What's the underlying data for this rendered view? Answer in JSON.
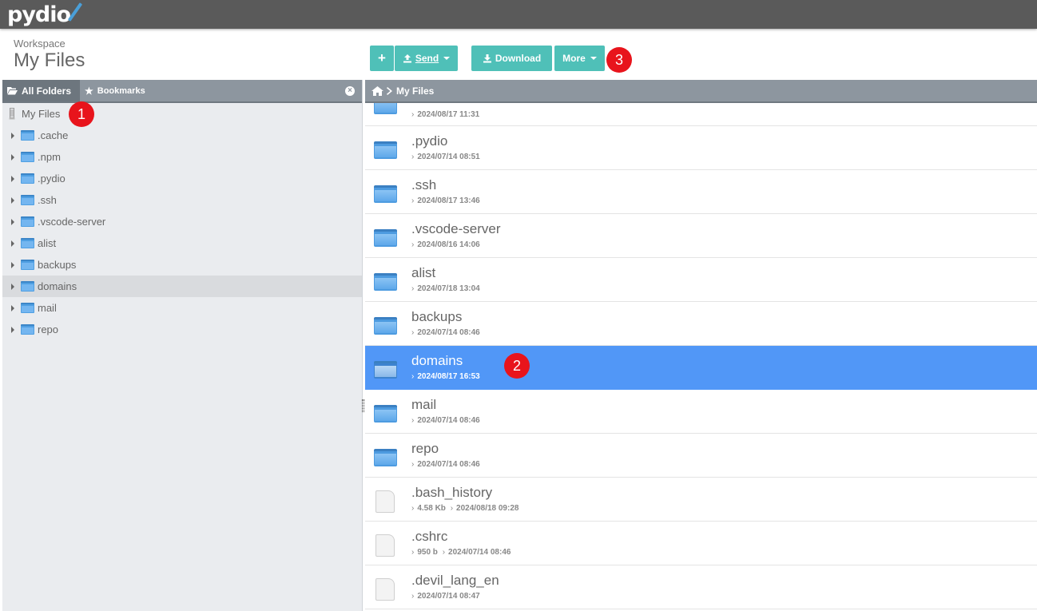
{
  "app": {
    "logo_text": "pydio"
  },
  "header": {
    "workspace_label": "Workspace",
    "title": "My Files"
  },
  "toolbar": {
    "new_label": "+",
    "send_label": "Send",
    "download_label": "Download",
    "more_label": "More"
  },
  "badges": [
    "1",
    "2",
    "3"
  ],
  "left_panel": {
    "tab_all_folders": "All Folders",
    "tab_bookmarks": "Bookmarks",
    "root_label": "My Files",
    "items": [
      {
        "label": ".cache"
      },
      {
        "label": ".npm"
      },
      {
        "label": ".pydio"
      },
      {
        "label": ".ssh"
      },
      {
        "label": ".vscode-server"
      },
      {
        "label": "alist"
      },
      {
        "label": "backups"
      },
      {
        "label": "domains",
        "selected": true
      },
      {
        "label": "mail"
      },
      {
        "label": "repo"
      }
    ]
  },
  "breadcrumb": {
    "label": "My Files"
  },
  "files": [
    {
      "name": "",
      "meta": "2024/08/17 11:31",
      "kind": "folder"
    },
    {
      "name": ".pydio",
      "meta": "2024/07/14 08:51",
      "kind": "folder"
    },
    {
      "name": ".ssh",
      "meta": "2024/08/17 13:46",
      "kind": "folder"
    },
    {
      "name": ".vscode-server",
      "meta": "2024/08/16 14:06",
      "kind": "folder"
    },
    {
      "name": "alist",
      "meta": "2024/07/18 13:04",
      "kind": "folder"
    },
    {
      "name": "backups",
      "meta": "2024/07/14 08:46",
      "kind": "folder"
    },
    {
      "name": "domains",
      "meta": "2024/08/17 16:53",
      "kind": "folder",
      "selected": true
    },
    {
      "name": "mail",
      "meta": "2024/07/14 08:46",
      "kind": "folder"
    },
    {
      "name": "repo",
      "meta": "2024/07/14 08:46",
      "kind": "folder"
    },
    {
      "name": ".bash_history",
      "size": "4.58 Kb",
      "meta": "2024/08/18 09:28",
      "kind": "file"
    },
    {
      "name": ".cshrc",
      "size": "950 b",
      "meta": "2024/07/14 08:46",
      "kind": "file"
    },
    {
      "name": ".devil_lang_en",
      "meta": "2024/07/14 08:47",
      "kind": "file"
    }
  ]
}
